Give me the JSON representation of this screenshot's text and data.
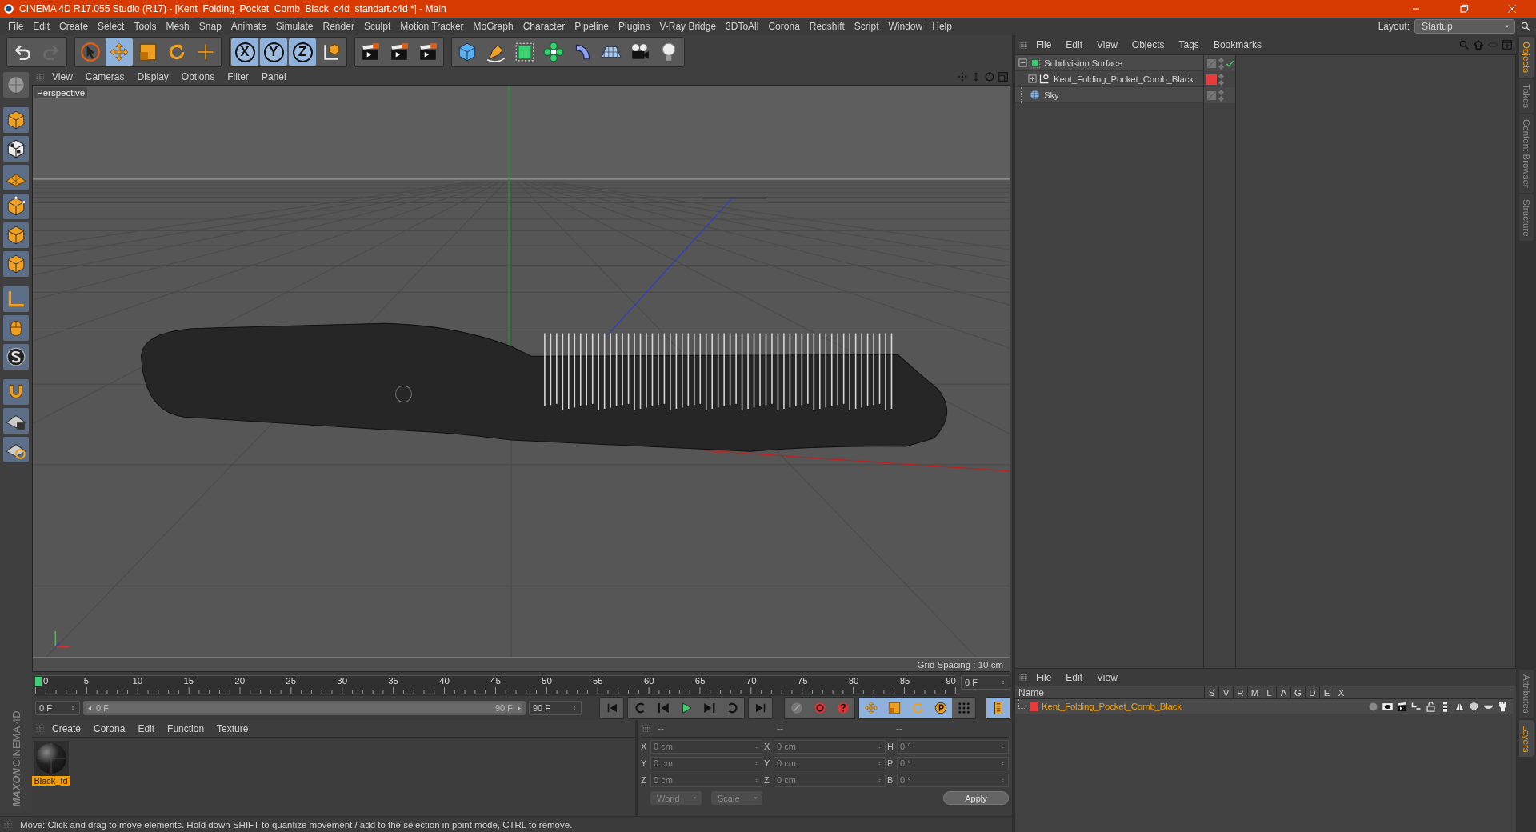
{
  "window": {
    "title": "CINEMA 4D R17.055 Studio (R17) - [Kent_Folding_Pocket_Comb_Black_c4d_standart.c4d *] - Main"
  },
  "menu": [
    "File",
    "Edit",
    "Create",
    "Select",
    "Tools",
    "Mesh",
    "Snap",
    "Animate",
    "Simulate",
    "Render",
    "Sculpt",
    "Motion Tracker",
    "MoGraph",
    "Character",
    "Pipeline",
    "Plugins",
    "V-Ray Bridge",
    "3DToAll",
    "Corona",
    "Redshift",
    "Script",
    "Window",
    "Help"
  ],
  "layout": {
    "label": "Layout:",
    "value": "Startup"
  },
  "toolbar": [
    [
      {
        "kind": "undo",
        "selected": false,
        "disabled": false
      },
      {
        "kind": "redo",
        "selected": false,
        "disabled": true
      }
    ],
    [
      {
        "kind": "select",
        "selected": false,
        "disabled": false
      },
      {
        "kind": "move",
        "selected": true,
        "disabled": false
      },
      {
        "kind": "scale",
        "selected": false,
        "disabled": false
      },
      {
        "kind": "rotate",
        "selected": false,
        "disabled": false
      },
      {
        "kind": "transform",
        "selected": false,
        "disabled": false
      }
    ],
    [
      {
        "kind": "axis",
        "label": "X",
        "selected": true,
        "disabled": false
      },
      {
        "kind": "axis",
        "label": "Y",
        "selected": true,
        "disabled": false
      },
      {
        "kind": "axis",
        "label": "Z",
        "selected": true,
        "disabled": false
      },
      {
        "kind": "coords",
        "selected": false,
        "disabled": false
      }
    ],
    [
      {
        "kind": "render",
        "selected": false,
        "disabled": false
      },
      {
        "kind": "render",
        "selected": false,
        "disabled": false
      },
      {
        "kind": "render",
        "selected": false,
        "disabled": false
      }
    ],
    [
      {
        "kind": "cube",
        "selected": false,
        "disabled": false
      },
      {
        "kind": "pen",
        "selected": false,
        "disabled": false
      },
      {
        "kind": "subdiv",
        "selected": false,
        "disabled": false
      },
      {
        "kind": "cloner",
        "selected": false,
        "disabled": false
      },
      {
        "kind": "deformer",
        "selected": false,
        "disabled": false
      },
      {
        "kind": "floor",
        "selected": false,
        "disabled": false
      },
      {
        "kind": "camera",
        "selected": false,
        "disabled": false
      },
      {
        "kind": "light",
        "selected": false,
        "disabled": false
      }
    ]
  ],
  "viewport": {
    "menu": [
      "View",
      "Cameras",
      "Display",
      "Options",
      "Filter",
      "Panel"
    ],
    "camera": "Perspective",
    "grid_spacing": "Grid Spacing : 10 cm"
  },
  "objects": {
    "menu": [
      "File",
      "Edit",
      "View",
      "Objects",
      "Tags",
      "Bookmarks"
    ],
    "items": [
      {
        "name": "Subdivision Surface",
        "kind": "subdivision",
        "expanded": true,
        "enabled": true,
        "children": [
          {
            "name": "Kent_Folding_Pocket_Comb_Black",
            "kind": "null",
            "expanded": false,
            "color": "#e83c3c"
          }
        ]
      },
      {
        "name": "Sky",
        "kind": "sky"
      }
    ]
  },
  "side_tabs_top": [
    {
      "label": "Objects",
      "selected": true
    },
    {
      "label": "Takes",
      "selected": false
    },
    {
      "label": "Content Browser",
      "selected": false
    },
    {
      "label": "Structure",
      "selected": false
    }
  ],
  "timeline": {
    "ticks": [
      "0",
      "5",
      "10",
      "15",
      "20",
      "25",
      "30",
      "35",
      "40",
      "45",
      "50",
      "55",
      "60",
      "65",
      "70",
      "75",
      "80",
      "85",
      "90"
    ],
    "current": "0 F",
    "start": "0 F",
    "level": 1,
    "range_start": "0 F",
    "range_end": "90 F",
    "end": "90 F"
  },
  "materials": {
    "menu": [
      "Create",
      "Corona",
      "Edit",
      "Function",
      "Texture"
    ],
    "items": [
      {
        "name": "Black_fd",
        "selected": true
      }
    ]
  },
  "coordinates": {
    "headers": [
      "--",
      "--",
      "--"
    ],
    "rows": [
      {
        "axis": "X",
        "position": "0 cm",
        "size_axis": "X",
        "size": "0 cm",
        "rot_axis": "H",
        "rotation": "0 °"
      },
      {
        "axis": "Y",
        "position": "0 cm",
        "size_axis": "Y",
        "size": "0 cm",
        "rot_axis": "P",
        "rotation": "0 °"
      },
      {
        "axis": "Z",
        "position": "0 cm",
        "size_axis": "Z",
        "size": "0 cm",
        "rot_axis": "B",
        "rotation": "0 °"
      }
    ],
    "mode": "World",
    "size_mode": "Scale",
    "apply": "Apply"
  },
  "layers": {
    "menu": [
      "File",
      "Edit",
      "View"
    ],
    "columns": [
      "Name",
      "S",
      "V",
      "R",
      "M",
      "L",
      "A",
      "G",
      "D",
      "E",
      "X"
    ],
    "rows": [
      {
        "name": "Kent_Folding_Pocket_Comb_Black",
        "color": "#e83c3c"
      }
    ]
  },
  "side_tabs_bottom": [
    {
      "label": "Attributes",
      "selected": false
    },
    {
      "label": "Layers",
      "selected": true
    }
  ],
  "brand": [
    "MAXON",
    "CINEMA 4D"
  ],
  "status": "Move: Click and drag to move elements. Hold down SHIFT to quantize movement / add to the selection in point mode, CTRL to remove."
}
